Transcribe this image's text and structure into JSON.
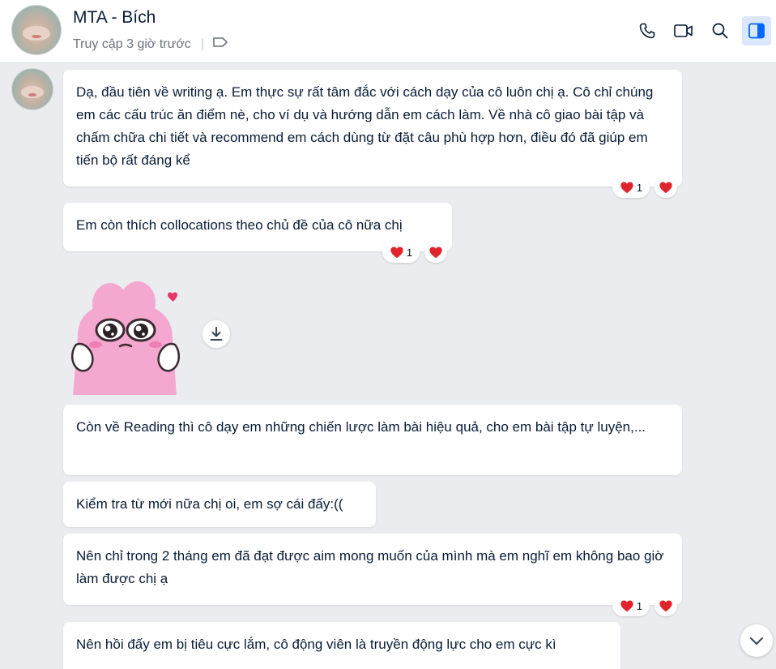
{
  "header": {
    "name": "MTA - Bích",
    "status": "Truy cập 3 giờ trước",
    "separator": "|",
    "icons": [
      "phone-icon",
      "video-icon",
      "search-icon",
      "sidebar-toggle-icon",
      "tag-icon"
    ]
  },
  "colors": {
    "accent": "#0068ff",
    "heart": "#e0242c",
    "background": "#ebecf0"
  },
  "messages": [
    {
      "text": "Dạ, đầu tiên về writing ạ. Em thực sự rất tâm đắc với cách dạy của cô luôn chị ạ. Cô chỉ chúng em các cấu trúc ăn điểm nè, cho ví dụ và hướng dẫn em cách làm. Về nhà cô giao bài tập và chấm chữa chi tiết và recommend em cách dùng từ đặt câu phù hợp hơn, điều đó đã giúp em tiến bộ rất đáng kể",
      "reaction_count": "1"
    },
    {
      "text": "Em còn thích collocations theo chủ đề của cô nữa chị",
      "reaction_count": "1"
    },
    {
      "text": "Còn về Reading thì cô dạy em những chiến lược làm bài hiệu quả, cho em bài tập tự luyện,..."
    },
    {
      "text": "Kiểm tra từ mới nữa chị oi, em sợ cái đấy:(("
    },
    {
      "text": "Nên chỉ trong 2 tháng em đã đạt được aim mong muốn của mình mà em nghĩ em không bao giờ làm được chị ạ",
      "reaction_count": "1"
    },
    {
      "text": "Nên hồi đấy em bị tiêu cực lắm, cô động viên là truyền động lực cho em cực kì"
    }
  ]
}
